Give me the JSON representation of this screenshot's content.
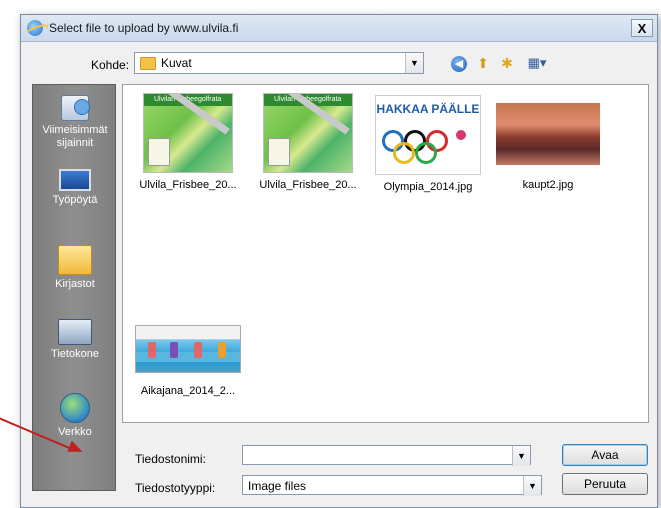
{
  "window": {
    "title": "Select file to upload by www.ulvila.fi",
    "close_glyph": "X"
  },
  "lookin": {
    "label": "Kohde:",
    "value": "Kuvat"
  },
  "toolbar": {
    "back_glyph": "◀",
    "up_glyph": "⬆",
    "newfolder_glyph": "✱",
    "views_glyph": "▦▾"
  },
  "places": [
    {
      "label": "Viimeisimmät sijainnit",
      "icon": "recent-places-icon"
    },
    {
      "label": "Työpöytä",
      "icon": "desktop-icon"
    },
    {
      "label": "Kirjastot",
      "icon": "libraries-icon"
    },
    {
      "label": "Tietokone",
      "icon": "computer-icon"
    },
    {
      "label": "Verkko",
      "icon": "network-icon"
    }
  ],
  "files": [
    {
      "name": "Ulvila_Frisbee_20...",
      "thumb_header": "Ulvilan frisbeegolfrata"
    },
    {
      "name": "Ulvila_Frisbee_20...",
      "thumb_header": "Ulvilan frisbeegolfrata"
    },
    {
      "name": "Olympia_2014.jpg",
      "thumb_text": "HAKKAA PÄÄLLE"
    },
    {
      "name": "kaupt2.jpg"
    },
    {
      "name": "Aikajana_2014_2..."
    }
  ],
  "filename": {
    "label": "Tiedostonimi:",
    "value": ""
  },
  "filetype": {
    "label": "Tiedostotyyppi:",
    "value": "Image files"
  },
  "buttons": {
    "open": "Avaa",
    "cancel": "Peruuta"
  },
  "combo_arrow_glyph": "▼",
  "colors": {
    "annotation_arrow": "#c0201f",
    "places_bar": "#858585"
  }
}
